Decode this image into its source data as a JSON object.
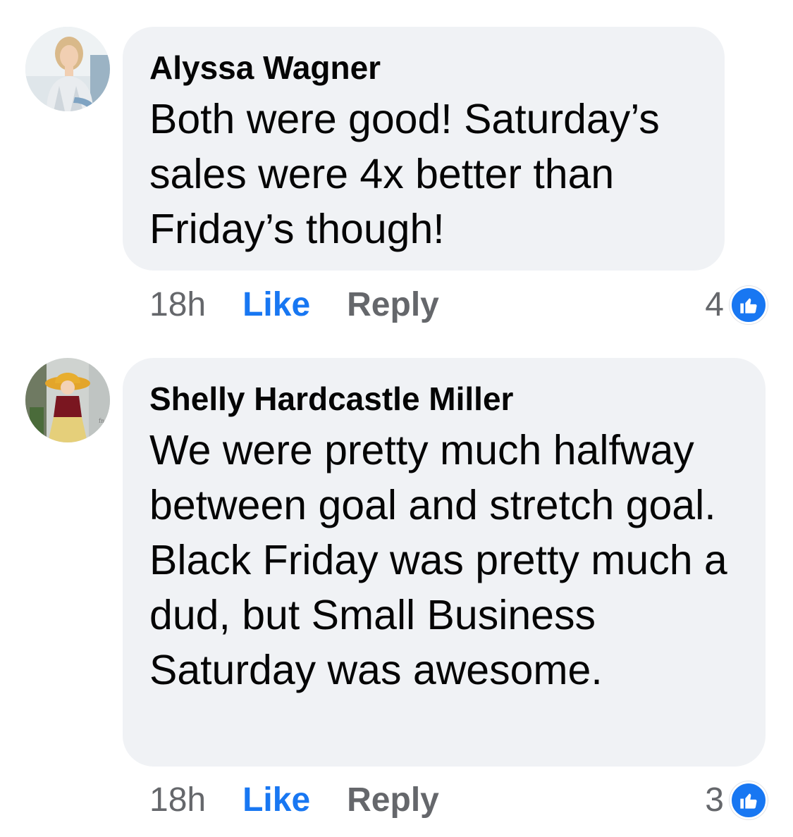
{
  "colors": {
    "bubble": "#f0f2f5",
    "text": "#050505",
    "secondary": "#65676b",
    "accent": "#1877f2"
  },
  "comments": [
    {
      "author": "Alyssa Wagner",
      "text": "Both were good! Saturday’s sales were 4x better than Friday’s though!",
      "time": "18h",
      "like_label": "Like",
      "reply_label": "Reply",
      "reaction_count": "4",
      "reaction_icon": "thumbs-up-icon"
    },
    {
      "author": "Shelly Hardcastle Miller",
      "text": "We were pretty much halfway between goal and stretch goal.  Black Friday was pretty much a dud, but Small Business Saturday was awesome.",
      "time": "18h",
      "like_label": "Like",
      "reply_label": "Reply",
      "reaction_count": "3",
      "reaction_icon": "thumbs-up-icon"
    }
  ]
}
